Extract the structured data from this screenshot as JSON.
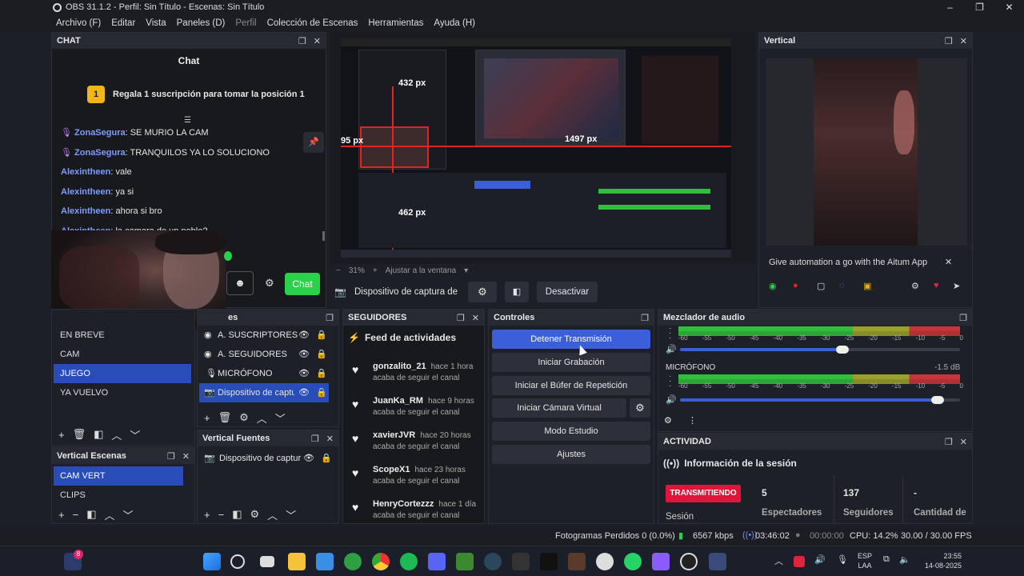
{
  "window": {
    "title": "OBS 31.1.2 - Perfil: Sin Título - Escenas: Sin Título"
  },
  "menu": [
    "Archivo (F)",
    "Editar",
    "Vista",
    "Paneles (D)",
    "Perfil",
    "Colección de Escenas",
    "Herramientas",
    "Ayuda (H)"
  ],
  "chat": {
    "dock_title": "CHAT",
    "header": "Chat",
    "promo_badge": "1",
    "promo": "Regala 1 suscripción para tomar la posición 1",
    "messages": [
      {
        "user": "ZonaSegura",
        "text": ": SE MURIO LA CAM"
      },
      {
        "user": "ZonaSegura",
        "text": ": TRANQUILOS YA LO SOLUCIONO"
      },
      {
        "user": "Alexintheen",
        "text": ": vale"
      },
      {
        "user": "Alexintheen",
        "text": ": ya si"
      },
      {
        "user": "Alexintheen",
        "text": ": ahora si bro"
      },
      {
        "user": "Alexintheen",
        "text": ": la camara de un poble?"
      }
    ],
    "send_label": "Chat"
  },
  "preview": {
    "zoom": "31%",
    "fit": "Ajustar a la ventana",
    "label_432": "432 px",
    "label_1497": "1497 px",
    "label_95": "95 px",
    "label_462": "462 px"
  },
  "source_bar": {
    "source": "Dispositivo de captura de v",
    "deactivate": "Desactivar"
  },
  "vertical": {
    "dock_title": "Vertical",
    "ad_text": "Give automation a go with the Aitum App",
    "close": "✕"
  },
  "scenes": {
    "items": [
      "EN BREVE",
      "CAM",
      "JUEGO",
      "YA VUELVO"
    ],
    "selected": 2
  },
  "sources": {
    "title_tail": "es",
    "items": [
      "A. SUSCRIPTORES",
      "A. SEGUIDORES",
      "MICRÓFONO",
      "Dispositivo de captu"
    ],
    "selected": 3
  },
  "vertical_scenes": {
    "title": "Vertical Escenas",
    "items": [
      "CAM VERT",
      "CLIPS"
    ],
    "selected": 0
  },
  "vertical_sources": {
    "title": "Vertical Fuentes",
    "items": [
      "Dispositivo de captur"
    ]
  },
  "followers": {
    "title": "SEGUIDORES",
    "feed": "Feed de actividades",
    "items": [
      {
        "name": "gonzalito_21",
        "time": "hace 1 hora",
        "sub": "acaba de seguir el canal"
      },
      {
        "name": "JuanKa_RM",
        "time": "hace 9 horas",
        "sub": "acaba de seguir el canal"
      },
      {
        "name": "xavierJVR",
        "time": "hace 20 horas",
        "sub": "acaba de seguir el canal"
      },
      {
        "name": "ScopeX1",
        "time": "hace 23 horas",
        "sub": "acaba de seguir el canal"
      },
      {
        "name": "HenryCortezzz",
        "time": "hace 1 día",
        "sub": "acaba de seguir el canal"
      }
    ]
  },
  "controls": {
    "title": "Controles",
    "buttons": [
      "Detener Transmisión",
      "Iniciar Grabación",
      "Iniciar el Búfer de Repetición",
      "Iniciar Cámara Virtual",
      "Modo Estudio",
      "Ajustes"
    ]
  },
  "mixer": {
    "title": "Mezclador de audio",
    "scale": [
      "-60",
      "-55",
      "-50",
      "-45",
      "-40",
      "-35",
      "-30",
      "-25",
      "-20",
      "-15",
      "-10",
      "-5",
      "0"
    ],
    "mic_label": "MICRÓFONO",
    "mic_db": "-1.5 dB",
    "ch1_volume": 0.58,
    "ch2_volume": 0.92
  },
  "activity": {
    "title": "ACTIVIDAD",
    "session_info": "Información de la sesión",
    "live_badge": "TRANSMITIENDO",
    "session_label": "Sesión",
    "viewers_value": "5",
    "viewers_label": "Espectadores",
    "followers_value": "137",
    "followers_label": "Seguidores",
    "amount_value": "-",
    "amount_label": "Cantidad de"
  },
  "statusbar": {
    "dropped": "Fotogramas Perdidos 0 (0.0%)",
    "bitrate": "6567 kbps",
    "stream_time": "03:46:02",
    "rec_time": "00:00:00",
    "cpu": "CPU: 14.2%",
    "fps": "30.00 / 30.00 FPS"
  },
  "taskbar": {
    "lang1": "ESP",
    "lang2": "LAA",
    "time": "23:55",
    "date": "14-08-2025",
    "notif": "8"
  }
}
